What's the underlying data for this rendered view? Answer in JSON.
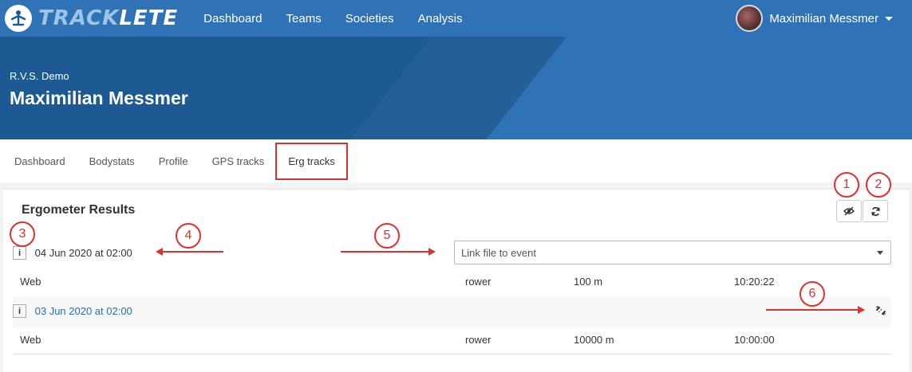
{
  "brand": {
    "prefix": "TRACK",
    "suffix": "LETE"
  },
  "nav": [
    "Dashboard",
    "Teams",
    "Societies",
    "Analysis"
  ],
  "user": {
    "name": "Maximilian Messmer"
  },
  "hero": {
    "org": "R.V.S. Demo",
    "title": "Maximilian Messmer"
  },
  "tabs": [
    "Dashboard",
    "Bodystats",
    "Profile",
    "GPS tracks",
    "Erg tracks"
  ],
  "panel": {
    "title": "Ergometer Results",
    "select_placeholder": "Link file to event",
    "entries": [
      {
        "date": "04 Jun 2020 at 02:00",
        "source": "Web",
        "type": "rower",
        "distance": "100 m",
        "time": "10:20:22"
      },
      {
        "date": "03 Jun 2020 at 02:00",
        "source": "Web",
        "type": "rower",
        "distance": "10000 m",
        "time": "10:00:00"
      }
    ]
  },
  "annotations": [
    "1",
    "2",
    "3",
    "4",
    "5",
    "6"
  ],
  "icons": {
    "visibility": "eye-off-icon",
    "refresh": "refresh-icon",
    "unlink": "unlink-icon",
    "info": "info-icon",
    "i_glyph": "i"
  },
  "colors": {
    "primary": "#2f73b6",
    "hero": "#1d5a93",
    "annotation": "#e0302d",
    "link": "#2a6eaf"
  }
}
